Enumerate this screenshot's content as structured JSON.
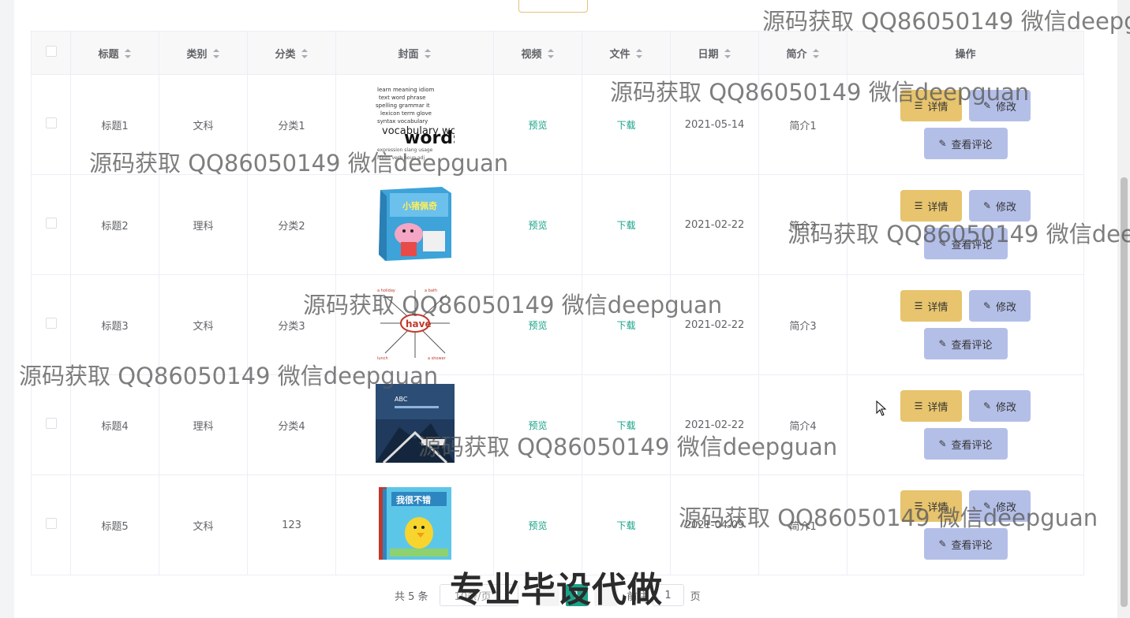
{
  "table": {
    "headers": [
      "标题",
      "类别",
      "分类",
      "封面",
      "视频",
      "文件",
      "日期",
      "简介",
      "操作"
    ],
    "rows": [
      {
        "title": "标题1",
        "type": "文科",
        "category": "分类1",
        "cover": "vocabulary words",
        "video": "预览",
        "file": "下载",
        "date": "2021-05-14",
        "intro": "简介1"
      },
      {
        "title": "标题2",
        "type": "理科",
        "category": "分类2",
        "cover": "小猪佩奇",
        "video": "预览",
        "file": "下载",
        "date": "2021-02-22",
        "intro": "简介2"
      },
      {
        "title": "标题3",
        "type": "文科",
        "category": "分类3",
        "cover": "have",
        "video": "预览",
        "file": "下载",
        "date": "2021-02-22",
        "intro": "简介3"
      },
      {
        "title": "标题4",
        "type": "理科",
        "category": "分类4",
        "cover": "ABC",
        "video": "预览",
        "file": "下载",
        "date": "2021-02-22",
        "intro": "简介4"
      },
      {
        "title": "标题5",
        "type": "文科",
        "category": "123",
        "cover": "我很不错",
        "video": "预览",
        "file": "下载",
        "date": "2021-04-09",
        "intro": "简介1"
      }
    ],
    "actions": {
      "detail": "详情",
      "edit": "修改",
      "comments": "查看评论"
    }
  },
  "pagination": {
    "total": "共 5 条",
    "page_size": "10条/页",
    "current_page": "1",
    "goto_label": "前往",
    "jump_value": "1",
    "unit": "页"
  },
  "overlays": {
    "watermark": "源码获取 QQ86050149 微信deepguan",
    "banner": "专业毕设代做"
  },
  "colors": {
    "detail_button": "#e7c46d",
    "edit_button": "#b4bfe8",
    "link": "#1aa38a"
  }
}
